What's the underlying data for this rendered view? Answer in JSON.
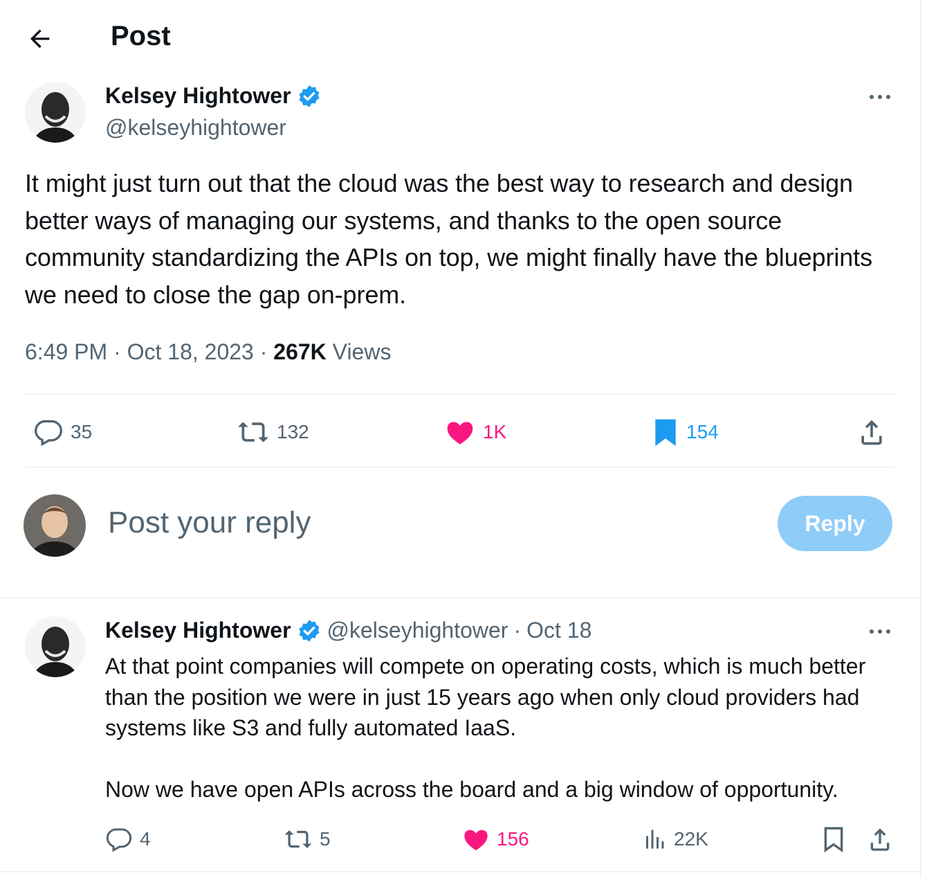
{
  "header": {
    "title": "Post"
  },
  "post": {
    "author_name": "Kelsey Hightower",
    "author_handle": "@kelseyhightower",
    "text": "It might just turn out that the cloud was the best way to research and design better ways of managing our systems, and thanks to the open source community standardizing the APIs on top, we might finally have the blueprints we need to close the gap on-prem.",
    "time": "6:49 PM",
    "date": "Oct 18, 2023",
    "views_count": "267K",
    "views_label": "Views",
    "replies": "35",
    "reposts": "132",
    "likes": "1K",
    "bookmarks": "154"
  },
  "composer": {
    "placeholder": "Post your reply",
    "button_label": "Reply"
  },
  "reply": {
    "author_name": "Kelsey Hightower",
    "author_handle": "@kelseyhightower",
    "date": "Oct 18",
    "paragraphs": [
      "At that point companies will compete on operating costs, which is much better than the position we were in just 15 years ago when only cloud providers had systems like S3 and fully automated IaaS.",
      "Now we have open APIs across the board and a big window of opportunity."
    ],
    "replies": "4",
    "reposts": "5",
    "likes": "156",
    "views": "22K"
  },
  "colors": {
    "verified": "#1d9bf0",
    "like": "#f91880",
    "bookmark": "#1d9bf0",
    "reply_button": "#8ecdf8",
    "secondary_text": "#536471"
  },
  "icons": [
    "back-arrow-icon",
    "verified-badge-icon",
    "more-icon",
    "reply-icon",
    "repost-icon",
    "like-icon",
    "bookmark-icon",
    "share-icon",
    "views-icon"
  ]
}
